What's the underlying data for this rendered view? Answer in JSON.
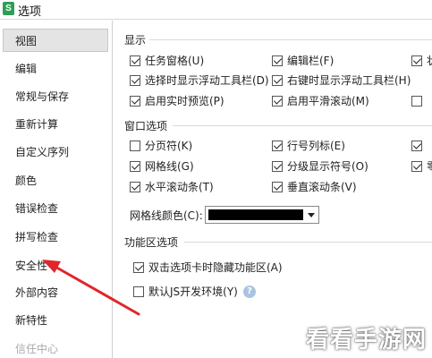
{
  "window": {
    "title": "选项",
    "app_icon_letter": "S"
  },
  "sidebar": {
    "items": [
      {
        "label": "视图",
        "selected": true
      },
      {
        "label": "编辑"
      },
      {
        "label": "常规与保存"
      },
      {
        "label": "重新计算"
      },
      {
        "label": "自定义序列"
      },
      {
        "label": "颜色"
      },
      {
        "label": "错误检查"
      },
      {
        "label": "拼写检查"
      },
      {
        "label": "安全性"
      },
      {
        "label": "外部内容"
      },
      {
        "label": "新特性"
      },
      {
        "label": "信任中心"
      }
    ]
  },
  "display_group": {
    "title": "显示",
    "options": [
      {
        "label": "任务窗格(U)",
        "checked": true
      },
      {
        "label": "编辑栏(F)",
        "checked": true
      },
      {
        "label": "状",
        "checked": true
      },
      {
        "label": "选择时显示浮动工具栏(D)",
        "checked": true
      },
      {
        "label": "右键时显示浮动工具栏(H)",
        "checked": true
      },
      {
        "label": "启用实时预览(P)",
        "checked": true
      },
      {
        "label": "启用平滑滚动(M)",
        "checked": true
      },
      {
        "label": "",
        "checked": false
      }
    ]
  },
  "window_group": {
    "title": "窗口选项",
    "options": [
      {
        "label": "分页符(K)",
        "checked": false
      },
      {
        "label": "行号列标(E)",
        "checked": true
      },
      {
        "label": "",
        "checked": true
      },
      {
        "label": "网格线(G)",
        "checked": true
      },
      {
        "label": "分级显示符号(O)",
        "checked": true
      },
      {
        "label": "零",
        "checked": true
      },
      {
        "label": "水平滚动条(T)",
        "checked": true
      },
      {
        "label": "垂直滚动条(V)",
        "checked": true
      }
    ],
    "gridline_color_label": "网格线颜色(C):",
    "gridline_color": "#000000"
  },
  "ribbon_group": {
    "title": "功能区选项",
    "options": [
      {
        "label": "双击选项卡时隐藏功能区(A)",
        "checked": true
      },
      {
        "label": "默认JS开发环境(Y)",
        "checked": false
      }
    ],
    "help_glyph": "?"
  },
  "annotation": {
    "arrow_color": "#e0262a"
  },
  "watermark": {
    "text": "看看手游网"
  }
}
